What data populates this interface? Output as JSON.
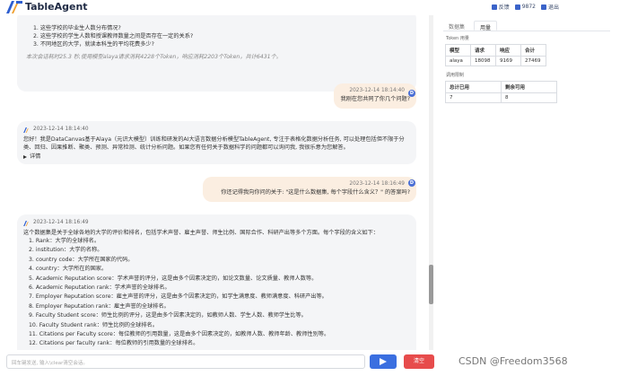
{
  "header": {
    "app_title": "TableAgent",
    "links": [
      {
        "label": "反馈",
        "icon": "feedback-icon"
      },
      {
        "label": "9872",
        "icon": "user-icon"
      },
      {
        "label": "退出",
        "icon": "logout-icon"
      }
    ]
  },
  "chat": {
    "first_ai": {
      "top_line": "1. 这些学校的毕业生人数分布情况?",
      "questions": [
        "1. 这些学校的毕业生人数分布情况?",
        "2. 这些学校的学生人数和授课教师数量之间是否存在一定的关系?",
        "3. 不同地区的大学，就读本科生的平均花费多少?"
      ],
      "cost_note": "本次会话耗时25.3 秒,使用模型alaya请求消耗4228个Token，响应消耗2203个Token，共计6431个。"
    },
    "user_msg_1": {
      "timestamp": "2023-12-14 18:14:40",
      "avatar": "D",
      "text": "我刚在您共同了你几个问题?"
    },
    "ai_msg_1": {
      "timestamp": "2023-12-14 18:14:40",
      "text": "您好！我是DataCanvas基于Alaya（元识大模型）训练和研发的AI大语言数据分析模型TableAgent, 专注于表格化数据分析任务, 可以处理包括但不限于分类、回归、因果推断、聚类、预测、异常检测、统计分析问题。如果您有任何关于数据科学的问题都可以询问我, 我很乐意为您解答。",
      "detail_label": "详情"
    },
    "user_msg_2": {
      "timestamp": "2023-12-14 18:16:49",
      "avatar": "D",
      "text": "你还记得我向你问的关于: \"这是什么数据集, 每个字段什么含义？\" 的答案吗?"
    },
    "ai_msg_2": {
      "timestamp": "2023-12-14 18:16:49",
      "intro": "这个数据集是关于全球各地的大学的评价和排名，包括学术声誉、雇主声誉、师生比例、国际合作、科研产出等多个方面。每个字段的含义如下：",
      "items": [
        "1. Rank：大学的全球排名。",
        "2. institution：大学的名称。",
        "3. country code：大学所在国家的代码。",
        "4. country：大学所在的国家。",
        "5. Academic Reputation score：学术声誉的评分，这是由多个因素决定的，如论文数量、论文质量、教师人数等。",
        "6. Academic Reputation rank：学术声誉的全球排名。",
        "7. Employer Reputation score：雇主声誉的评分，这是由多个因素决定的，如学生满意度、教师满意度、科研产出等。",
        "8. Employer Reputation rank：雇主声誉的全球排名。",
        "9. Faculty Student score：师生比例的评分，这是由多个因素决定的，如教师人数、学生人数、教师学生比等。",
        "10. Faculty Student rank：师生比例的全球排名。",
        "11. Citations per Faculty score：每位教师的引用数量，这是由多个因素决定的，如教师人数、教师年龄、教师性别等。",
        "12. Citations per faculty rank：每位教师的引用数量的全球排名。"
      ]
    }
  },
  "input": {
    "placeholder": "回车键发送, 输入\\clear清空会话。",
    "clear_label": "清空"
  },
  "panel": {
    "tabs": [
      "数据集",
      "用量"
    ],
    "active_tab": "用量",
    "token_title": "Token 用量",
    "token_headers": [
      "模型",
      "请求",
      "响应",
      "合计"
    ],
    "token_row": [
      "alaya",
      "18098",
      "9169",
      "27469"
    ],
    "call_title": "调用限制",
    "call_headers": [
      "总计已用",
      "剩余可用"
    ],
    "call_row": [
      "7",
      "8"
    ]
  },
  "watermark": "CSDN @Freedom3568",
  "colors": {
    "accent": "#3b6fe0",
    "danger": "#e74c4c",
    "user_bubble": "#fbeee1",
    "ai_bubble": "#f4f5f7"
  }
}
